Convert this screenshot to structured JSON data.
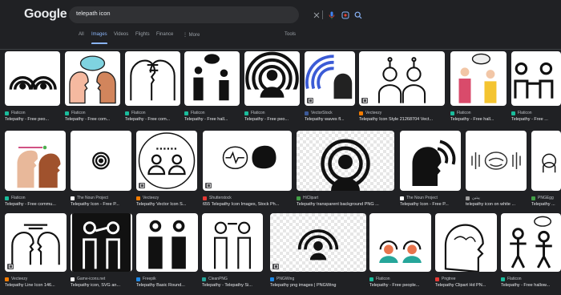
{
  "header": {
    "logo": "Google",
    "search": {
      "value": "telepath icon"
    }
  },
  "tabs": [
    {
      "label": "All",
      "active": false
    },
    {
      "label": "Images",
      "active": true
    },
    {
      "label": "Videos",
      "active": false
    },
    {
      "label": "Flights",
      "active": false
    },
    {
      "label": "Finance",
      "active": false
    },
    {
      "label": "⋮ More",
      "active": false
    },
    {
      "label": "Tools",
      "active": false
    }
  ],
  "colors": {
    "accent": "#8ab4f8",
    "background": "#202124",
    "mic": "#4285f4"
  },
  "results": [
    {
      "source": "Flaticon",
      "title": "Telepathy - Free peo...",
      "icon": "two-heads-signal-icon",
      "fav": "#1abc9c"
    },
    {
      "source": "Flaticon",
      "title": "Telepathy - Free com...",
      "icon": "colored-faces-thought-icon",
      "fav": "#1abc9c"
    },
    {
      "source": "Flaticon",
      "title": "Telepathy - Free com...",
      "icon": "two-faces-line-icon",
      "fav": "#1abc9c"
    },
    {
      "source": "Flaticon",
      "title": "Telepathy - Free hall...",
      "icon": "two-people-cloud-icon",
      "fav": "#1abc9c"
    },
    {
      "source": "Flaticon",
      "title": "Telepathy - Free peo...",
      "icon": "person-waves-icon",
      "fav": "#1abc9c"
    },
    {
      "source": "VectorStock",
      "title": "Telepathy waves fl...",
      "icon": "blue-waves-head-icon",
      "fav": "#3b5998"
    },
    {
      "source": "Vecteezy",
      "title": "Telepathy Icon Style 21268704 Vect...",
      "icon": "two-robots-line-icon",
      "fav": "#f57c00"
    },
    {
      "source": "Flaticon",
      "title": "Telepathy - Free hall...",
      "icon": "colored-people-cloud-icon",
      "fav": "#1abc9c"
    },
    {
      "source": "Flaticon",
      "title": "Telepathy - Free ...",
      "icon": "people-connect-icon",
      "fav": "#1abc9c"
    },
    {
      "source": "Flaticon",
      "title": "Telepathy - Free commu...",
      "icon": "brown-heads-icon",
      "fav": "#1abc9c"
    },
    {
      "source": "The Noun Project",
      "title": "Telepathy Icon - Free P...",
      "icon": "small-signal-icon",
      "fav": "#ffffff"
    },
    {
      "source": "Vecteezy",
      "title": "Telepathy Vector Icon S...",
      "icon": "circle-people-icon",
      "fav": "#f57c00"
    },
    {
      "source": "Shutterstock",
      "title": "655 Telepathy Icon Images, Stock Ph...",
      "icon": "brain-waves-icon",
      "fav": "#e53935"
    },
    {
      "source": "HiClipart",
      "title": "Telepathy transparent background PNG ...",
      "icon": "checker-waves-icon",
      "fav": "#43a047"
    },
    {
      "source": "The Noun Project",
      "title": "Telepathy Icon - Free P...",
      "icon": "head-waves-icon",
      "fav": "#ffffff"
    },
    {
      "source": "پیتین",
      "title": "telepathy icon on white ...",
      "icon": "brain-lines-icon",
      "fav": "#9e9e9e"
    },
    {
      "source": "PNGEgg",
      "title": "Telepathy ...",
      "icon": "partial-icon",
      "fav": "#43a047"
    },
    {
      "source": "Vecteezy",
      "title": "Telepathy Line Icon 146...",
      "icon": "line-heads-icon",
      "fav": "#f57c00"
    },
    {
      "source": "Game-icons.net",
      "title": "Telepathy icon, SVG an...",
      "icon": "black-figures-icon",
      "fav": "#ffffff"
    },
    {
      "source": "Freepik",
      "title": "Telepathy Basic Round...",
      "icon": "round-figures-icon",
      "fav": "#1e88e5"
    },
    {
      "source": "CleanPNG",
      "title": "Telepathy - Telepathy Si...",
      "icon": "outline-figures-icon",
      "fav": "#26a69a"
    },
    {
      "source": "PNGWing",
      "title": "Telepathy png images | PNGWing",
      "icon": "checker-person-icon",
      "fav": "#1e88e5"
    },
    {
      "source": "Flaticon",
      "title": "Telepathy - Free people...",
      "icon": "teal-people-icon",
      "fav": "#1abc9c"
    },
    {
      "source": "Pngtree",
      "title": "Telepathy Clipart Hd PN...",
      "icon": "head-brain-icon",
      "fav": "#e53935"
    },
    {
      "source": "Flaticon",
      "title": "Telepathy - Free hallow...",
      "icon": "stick-people-icon",
      "fav": "#1abc9c"
    }
  ]
}
